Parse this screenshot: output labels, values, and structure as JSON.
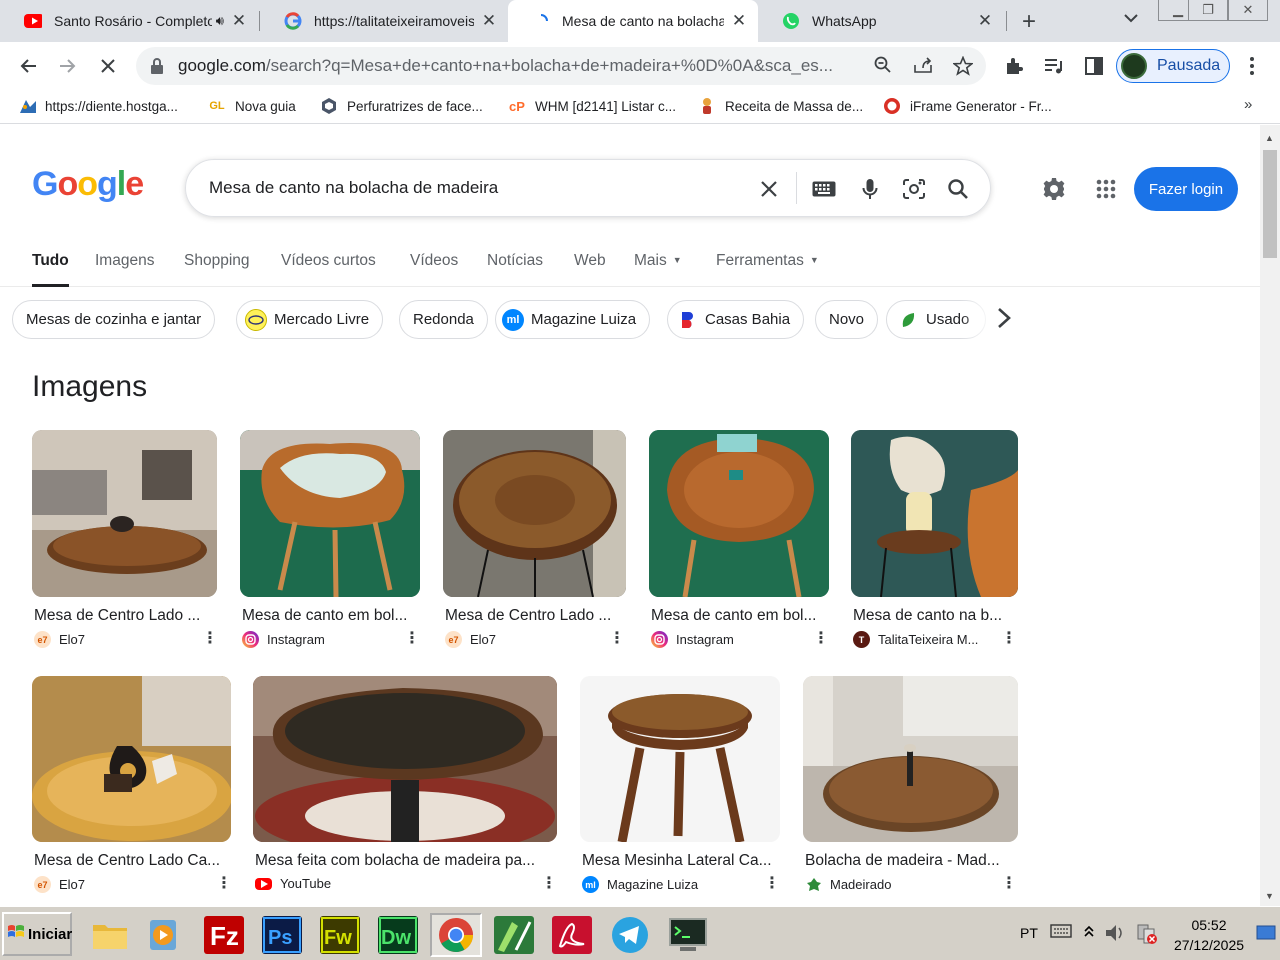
{
  "tabs": [
    {
      "title": "Santo Rosário - Completo",
      "favicon": "youtube-icon",
      "audio": true
    },
    {
      "title": "https://talitateixeiramoveise",
      "favicon": "google-icon"
    },
    {
      "title": "Mesa de canto na bolacha de",
      "favicon": "loading-icon",
      "active": true
    },
    {
      "title": "WhatsApp",
      "favicon": "whatsapp-icon"
    }
  ],
  "address_bar": {
    "domain": "google.com",
    "path": "/search?q=Mesa+de+canto+na+bolacha+de+madeira+%0D%0A&sca_es..."
  },
  "profile": {
    "label": "Pausada"
  },
  "bookmarks": [
    {
      "label": "https://diente.hostga...",
      "icon": "hostgator-icon"
    },
    {
      "label": "Nova guia",
      "icon": "gl-icon"
    },
    {
      "label": "Perfuratrizes de face...",
      "icon": "cube-icon"
    },
    {
      "label": "WHM [d2141] Listar c...",
      "icon": "cpanel-icon"
    },
    {
      "label": "Receita de Massa de...",
      "icon": "chef-icon"
    },
    {
      "label": "iFrame Generator - Fr...",
      "icon": "iframe-icon"
    }
  ],
  "logo": {
    "letters": [
      "G",
      "o",
      "o",
      "g",
      "l",
      "e"
    ],
    "colors": [
      "#4285f4",
      "#ea4335",
      "#fbbc05",
      "#4285f4",
      "#34a853",
      "#ea4335"
    ]
  },
  "search": {
    "query": "Mesa de canto na bolacha de madeira"
  },
  "login_label": "Fazer login",
  "nav_tabs": [
    {
      "label": "Tudo",
      "selected": true
    },
    {
      "label": "Imagens"
    },
    {
      "label": "Shopping"
    },
    {
      "label": "Vídeos curtos"
    },
    {
      "label": "Vídeos"
    },
    {
      "label": "Notícias"
    },
    {
      "label": "Web"
    },
    {
      "label": "Mais",
      "dropdown": true
    },
    {
      "label": "Ferramentas",
      "dropdown": true
    }
  ],
  "chips": [
    {
      "label": "Mesas de cozinha e jantar"
    },
    {
      "label": "Mercado Livre",
      "icon": "mercadolivre-icon"
    },
    {
      "label": "Redonda"
    },
    {
      "label": "Magazine Luiza",
      "icon": "magalu-icon"
    },
    {
      "label": "Casas Bahia",
      "icon": "casasbahia-icon"
    },
    {
      "label": "Novo"
    },
    {
      "label": "Usado",
      "icon": "leaf-icon"
    }
  ],
  "images_heading": "Imagens",
  "image_results": [
    {
      "title": "Mesa de Centro Lado ...",
      "source": "Elo7",
      "source_icon": "elo7-icon"
    },
    {
      "title": "Mesa de canto em bol...",
      "source": "Instagram",
      "source_icon": "instagram-icon"
    },
    {
      "title": "Mesa de Centro Lado ...",
      "source": "Elo7",
      "source_icon": "elo7-icon"
    },
    {
      "title": "Mesa de canto em bol...",
      "source": "Instagram",
      "source_icon": "instagram-icon"
    },
    {
      "title": "Mesa de canto na b...",
      "source": "TalitaTeixeira M...",
      "source_icon": "talita-icon"
    },
    {
      "title": "Mesa de Centro Lado Ca...",
      "source": "Elo7",
      "source_icon": "elo7-icon"
    },
    {
      "title": "Mesa feita com bolacha de madeira pa...",
      "source": "YouTube",
      "source_icon": "youtube-icon"
    },
    {
      "title": "Mesa Mesinha Lateral Ca...",
      "source": "Magazine Luiza",
      "source_icon": "magalu-icon"
    },
    {
      "title": "Bolacha de madeira - Mad...",
      "source": "Madeirado",
      "source_icon": "madeirado-icon"
    }
  ],
  "taskbar": {
    "start_label": "Iniciar",
    "apps": [
      "explorer-icon",
      "media-player-icon",
      "filezilla-icon",
      "photoshop-icon",
      "fireworks-icon",
      "dreamweaver-icon",
      "chrome-icon",
      "gimp-icon",
      "acrobat-icon",
      "telegram-icon",
      "terminal-icon"
    ],
    "language": "PT",
    "time": "05:52",
    "date": "27/12/2025"
  }
}
